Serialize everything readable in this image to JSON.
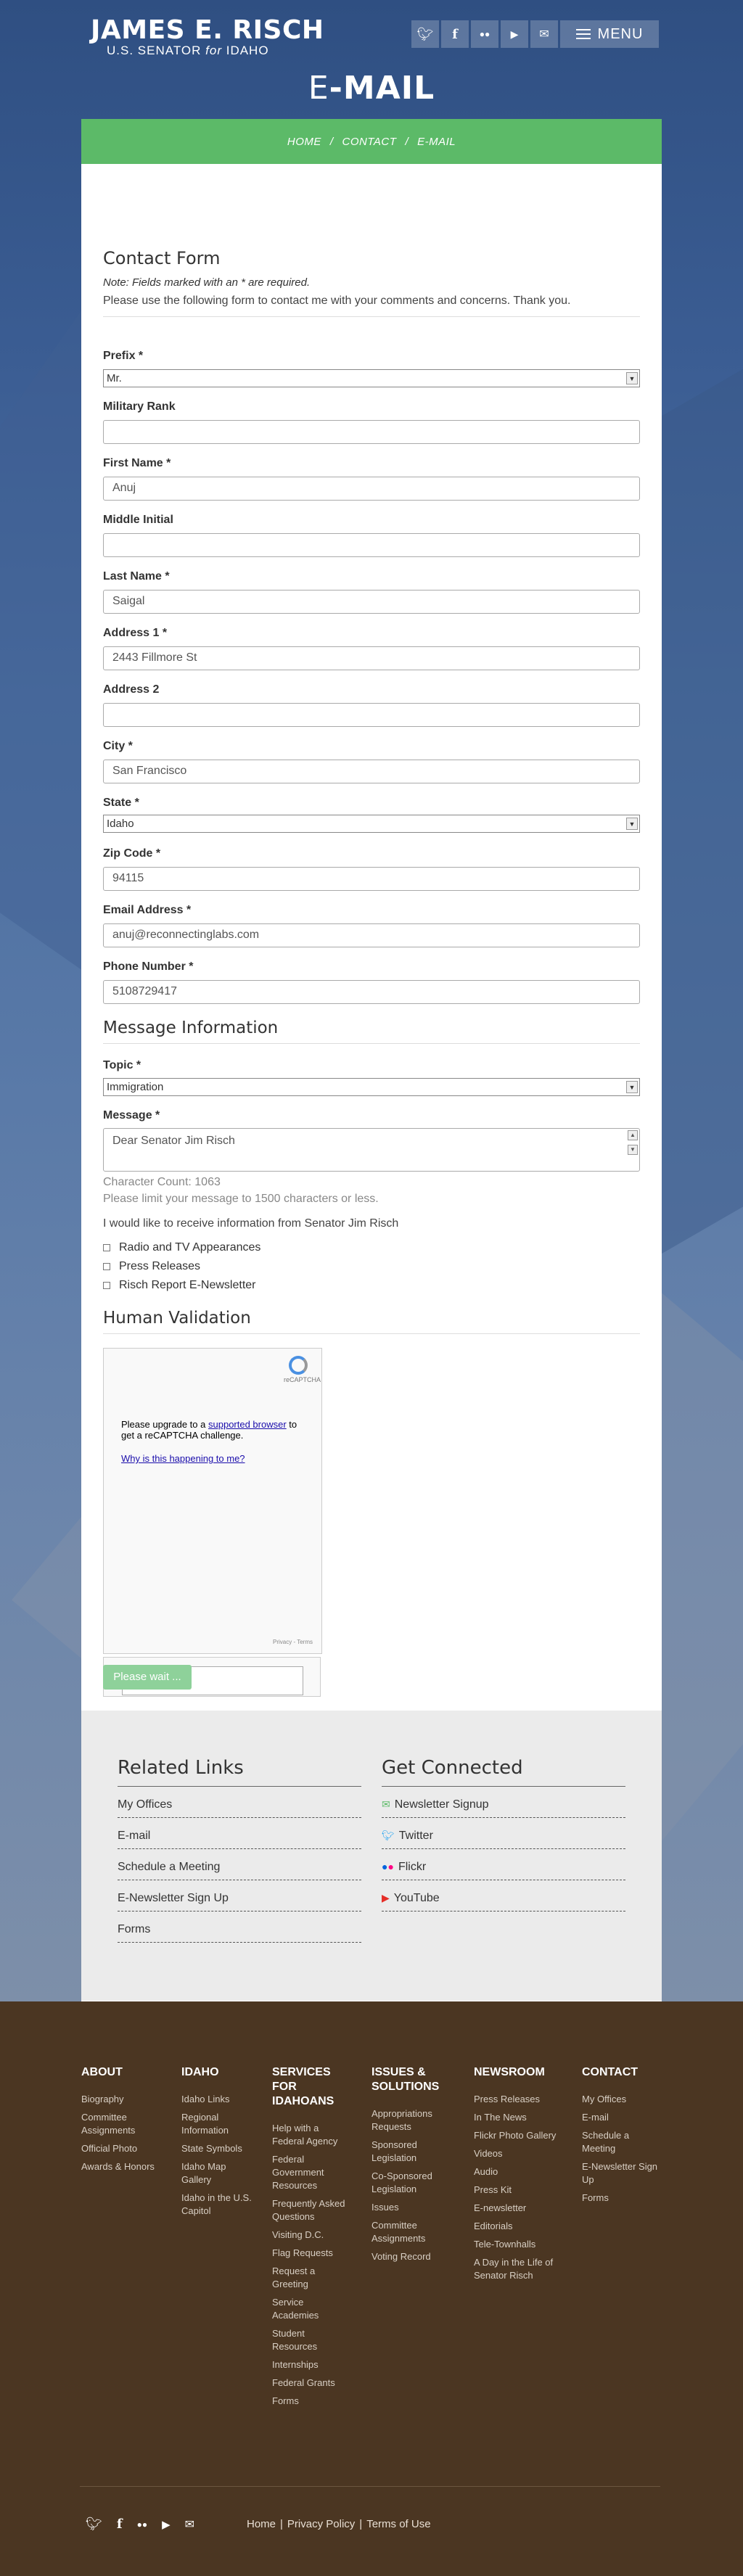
{
  "header": {
    "senator_name": "JAMES E. RISCH",
    "senator_sub_pre": "U.S. SENATOR",
    "senator_sub_for": "for",
    "senator_sub_state": "IDAHO",
    "social_icons": [
      "twitter-icon",
      "facebook-icon",
      "flickr-icon",
      "youtube-icon",
      "email-icon"
    ],
    "menu_label": "MENU",
    "page_title_first": "E",
    "page_title_rest": "-MAIL"
  },
  "breadcrumb": {
    "items": [
      "HOME",
      "CONTACT",
      "E-MAIL"
    ],
    "separator": "/"
  },
  "form": {
    "title": "Contact Form",
    "note": "Note: Fields marked with an * are required.",
    "intro": "Please use the following form to contact me with your comments and concerns. Thank you.",
    "prefix": {
      "label": "Prefix *",
      "value": "Mr."
    },
    "military_rank": {
      "label": "Military Rank",
      "value": ""
    },
    "first_name": {
      "label": "First Name *",
      "value": "Anuj"
    },
    "middle_initial": {
      "label": "Middle Initial",
      "value": ""
    },
    "last_name": {
      "label": "Last Name *",
      "value": "Saigal"
    },
    "address1": {
      "label": "Address 1 *",
      "value": "2443 Fillmore St"
    },
    "address2": {
      "label": "Address 2",
      "value": ""
    },
    "city": {
      "label": "City *",
      "value": "San Francisco"
    },
    "state": {
      "label": "State *",
      "value": "Idaho"
    },
    "zip": {
      "label": "Zip Code *",
      "value": "94115"
    },
    "email": {
      "label": "Email Address *",
      "value": "anuj@reconnectinglabs.com"
    },
    "phone": {
      "label": "Phone Number *",
      "value": "5108729417"
    }
  },
  "message": {
    "title": "Message Information",
    "topic": {
      "label": "Topic *",
      "value": "Immigration"
    },
    "message": {
      "label": "Message *",
      "value": "Dear Senator Jim Risch"
    },
    "char_count": "Character Count: 1063",
    "limit_note": "Please limit your message to 1500 characters or less.",
    "info_prompt": "I would like to receive information from Senator Jim Risch",
    "options": [
      "Radio and TV Appearances",
      "Press Releases",
      "Risch Report E-Newsletter"
    ]
  },
  "validation": {
    "title": "Human Validation",
    "recaptcha_brand": "reCAPTCHA",
    "upgrade_pre": "Please upgrade to a",
    "upgrade_link": "supported browser",
    "upgrade_post": "to get a reCAPTCHA challenge.",
    "why_link": "Why is this happening to me?",
    "privacy_terms": "Privacy - Terms",
    "submit_label": "Please wait ..."
  },
  "related": {
    "title": "Related Links",
    "links": [
      "My Offices",
      "E-mail",
      "Schedule a Meeting",
      "E-Newsletter Sign Up",
      "Forms"
    ]
  },
  "connected": {
    "title": "Get Connected",
    "links": [
      {
        "label": "Newsletter Signup",
        "icon": "envelope-icon"
      },
      {
        "label": "Twitter",
        "icon": "twitter-icon"
      },
      {
        "label": "Flickr",
        "icon": "flickr-icon"
      },
      {
        "label": "YouTube",
        "icon": "youtube-icon"
      }
    ]
  },
  "footer": {
    "columns": [
      {
        "title": "ABOUT",
        "links": [
          "Biography",
          "Committee Assignments",
          "Official Photo",
          "Awards & Honors"
        ]
      },
      {
        "title": "IDAHO",
        "links": [
          "Idaho Links",
          "Regional Information",
          "State Symbols",
          "Idaho Map Gallery",
          "Idaho in the U.S. Capitol"
        ]
      },
      {
        "title": "SERVICES FOR IDAHOANS",
        "links": [
          "Help with a Federal Agency",
          "Federal Government Resources",
          "Frequently Asked Questions",
          "Visiting D.C.",
          "Flag Requests",
          "Request a Greeting",
          "Service Academies",
          "Student Resources",
          "Internships",
          "Federal Grants",
          "Forms"
        ]
      },
      {
        "title": "ISSUES & SOLUTIONS",
        "links": [
          "Appropriations Requests",
          "Sponsored Legislation",
          "Co-Sponsored Legislation",
          "Issues",
          "Committee Assignments",
          "Voting Record"
        ]
      },
      {
        "title": "NEWSROOM",
        "links": [
          "Press Releases",
          "In The News",
          "Flickr Photo Gallery",
          "Videos",
          "Audio",
          "Press Kit",
          "E-newsletter",
          "Editorials",
          "Tele-Townhalls",
          "A Day in the Life of Senator Risch"
        ]
      },
      {
        "title": "CONTACT",
        "links": [
          "My Offices",
          "E-mail",
          "Schedule a Meeting",
          "E-Newsletter Sign Up",
          "Forms"
        ]
      }
    ],
    "legal": [
      "Home",
      "Privacy Policy",
      "Terms of Use"
    ],
    "legal_sep": "|",
    "colors": {
      "background": "#4b3622",
      "accent_green": "#5cba68"
    }
  }
}
